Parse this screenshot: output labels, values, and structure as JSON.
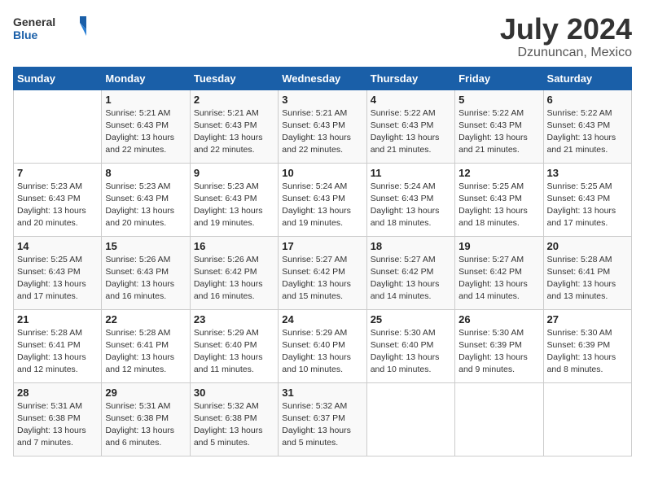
{
  "header": {
    "logo_general": "General",
    "logo_blue": "Blue",
    "month_title": "July 2024",
    "location": "Dzununcan, Mexico"
  },
  "calendar": {
    "days_of_week": [
      "Sunday",
      "Monday",
      "Tuesday",
      "Wednesday",
      "Thursday",
      "Friday",
      "Saturday"
    ],
    "weeks": [
      [
        {
          "day": "",
          "info": ""
        },
        {
          "day": "1",
          "info": "Sunrise: 5:21 AM\nSunset: 6:43 PM\nDaylight: 13 hours\nand 22 minutes."
        },
        {
          "day": "2",
          "info": "Sunrise: 5:21 AM\nSunset: 6:43 PM\nDaylight: 13 hours\nand 22 minutes."
        },
        {
          "day": "3",
          "info": "Sunrise: 5:21 AM\nSunset: 6:43 PM\nDaylight: 13 hours\nand 22 minutes."
        },
        {
          "day": "4",
          "info": "Sunrise: 5:22 AM\nSunset: 6:43 PM\nDaylight: 13 hours\nand 21 minutes."
        },
        {
          "day": "5",
          "info": "Sunrise: 5:22 AM\nSunset: 6:43 PM\nDaylight: 13 hours\nand 21 minutes."
        },
        {
          "day": "6",
          "info": "Sunrise: 5:22 AM\nSunset: 6:43 PM\nDaylight: 13 hours\nand 21 minutes."
        }
      ],
      [
        {
          "day": "7",
          "info": "Sunrise: 5:23 AM\nSunset: 6:43 PM\nDaylight: 13 hours\nand 20 minutes."
        },
        {
          "day": "8",
          "info": "Sunrise: 5:23 AM\nSunset: 6:43 PM\nDaylight: 13 hours\nand 20 minutes."
        },
        {
          "day": "9",
          "info": "Sunrise: 5:23 AM\nSunset: 6:43 PM\nDaylight: 13 hours\nand 19 minutes."
        },
        {
          "day": "10",
          "info": "Sunrise: 5:24 AM\nSunset: 6:43 PM\nDaylight: 13 hours\nand 19 minutes."
        },
        {
          "day": "11",
          "info": "Sunrise: 5:24 AM\nSunset: 6:43 PM\nDaylight: 13 hours\nand 18 minutes."
        },
        {
          "day": "12",
          "info": "Sunrise: 5:25 AM\nSunset: 6:43 PM\nDaylight: 13 hours\nand 18 minutes."
        },
        {
          "day": "13",
          "info": "Sunrise: 5:25 AM\nSunset: 6:43 PM\nDaylight: 13 hours\nand 17 minutes."
        }
      ],
      [
        {
          "day": "14",
          "info": "Sunrise: 5:25 AM\nSunset: 6:43 PM\nDaylight: 13 hours\nand 17 minutes."
        },
        {
          "day": "15",
          "info": "Sunrise: 5:26 AM\nSunset: 6:43 PM\nDaylight: 13 hours\nand 16 minutes."
        },
        {
          "day": "16",
          "info": "Sunrise: 5:26 AM\nSunset: 6:42 PM\nDaylight: 13 hours\nand 16 minutes."
        },
        {
          "day": "17",
          "info": "Sunrise: 5:27 AM\nSunset: 6:42 PM\nDaylight: 13 hours\nand 15 minutes."
        },
        {
          "day": "18",
          "info": "Sunrise: 5:27 AM\nSunset: 6:42 PM\nDaylight: 13 hours\nand 14 minutes."
        },
        {
          "day": "19",
          "info": "Sunrise: 5:27 AM\nSunset: 6:42 PM\nDaylight: 13 hours\nand 14 minutes."
        },
        {
          "day": "20",
          "info": "Sunrise: 5:28 AM\nSunset: 6:41 PM\nDaylight: 13 hours\nand 13 minutes."
        }
      ],
      [
        {
          "day": "21",
          "info": "Sunrise: 5:28 AM\nSunset: 6:41 PM\nDaylight: 13 hours\nand 12 minutes."
        },
        {
          "day": "22",
          "info": "Sunrise: 5:28 AM\nSunset: 6:41 PM\nDaylight: 13 hours\nand 12 minutes."
        },
        {
          "day": "23",
          "info": "Sunrise: 5:29 AM\nSunset: 6:40 PM\nDaylight: 13 hours\nand 11 minutes."
        },
        {
          "day": "24",
          "info": "Sunrise: 5:29 AM\nSunset: 6:40 PM\nDaylight: 13 hours\nand 10 minutes."
        },
        {
          "day": "25",
          "info": "Sunrise: 5:30 AM\nSunset: 6:40 PM\nDaylight: 13 hours\nand 10 minutes."
        },
        {
          "day": "26",
          "info": "Sunrise: 5:30 AM\nSunset: 6:39 PM\nDaylight: 13 hours\nand 9 minutes."
        },
        {
          "day": "27",
          "info": "Sunrise: 5:30 AM\nSunset: 6:39 PM\nDaylight: 13 hours\nand 8 minutes."
        }
      ],
      [
        {
          "day": "28",
          "info": "Sunrise: 5:31 AM\nSunset: 6:38 PM\nDaylight: 13 hours\nand 7 minutes."
        },
        {
          "day": "29",
          "info": "Sunrise: 5:31 AM\nSunset: 6:38 PM\nDaylight: 13 hours\nand 6 minutes."
        },
        {
          "day": "30",
          "info": "Sunrise: 5:32 AM\nSunset: 6:38 PM\nDaylight: 13 hours\nand 5 minutes."
        },
        {
          "day": "31",
          "info": "Sunrise: 5:32 AM\nSunset: 6:37 PM\nDaylight: 13 hours\nand 5 minutes."
        },
        {
          "day": "",
          "info": ""
        },
        {
          "day": "",
          "info": ""
        },
        {
          "day": "",
          "info": ""
        }
      ]
    ]
  }
}
